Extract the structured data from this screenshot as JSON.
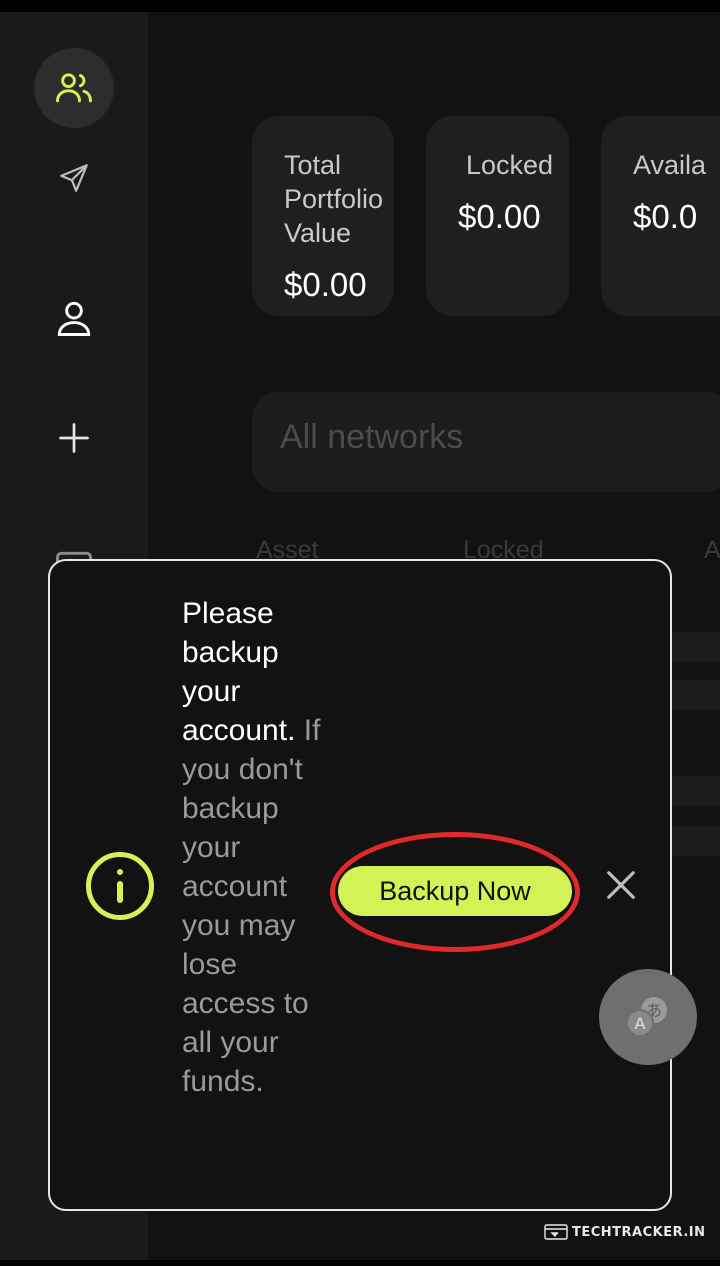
{
  "sidebar": {
    "items": [
      {
        "icon": "users-icon",
        "active": true
      },
      {
        "icon": "send-icon",
        "active": false
      },
      {
        "icon": "user-icon",
        "active": false
      },
      {
        "icon": "plus-icon",
        "active": false
      },
      {
        "icon": "image-icon",
        "active": false
      }
    ]
  },
  "portfolio": {
    "cards": [
      {
        "label": "Total\nPortfolio\nValue",
        "value": "$0.00"
      },
      {
        "label": "Locked",
        "value": "$0.00"
      },
      {
        "label": "Availa",
        "value": "$0.0"
      }
    ]
  },
  "network_filter": {
    "placeholder": "All networks"
  },
  "table": {
    "headers": [
      "Asset",
      "Locked",
      "A"
    ]
  },
  "backup_modal": {
    "title": "Please backup your account.",
    "body": "If you don't backup your account you may lose access to all your funds.",
    "button_label": "Backup Now",
    "accent_color": "#d4f255",
    "highlight_color": "#e02a2a"
  },
  "watermark": {
    "text": "TECHTRACKER.IN"
  }
}
